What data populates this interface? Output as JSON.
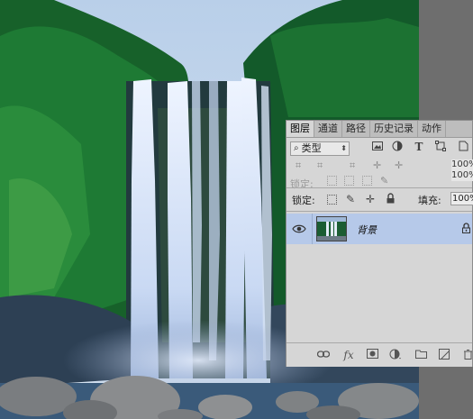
{
  "panel": {
    "tabs": [
      {
        "label": "图层",
        "active": true
      },
      {
        "label": "通道",
        "active": false
      },
      {
        "label": "路径",
        "active": false
      },
      {
        "label": "历史记录",
        "active": false
      },
      {
        "label": "动作",
        "active": false
      }
    ],
    "filter": {
      "kind_label": "类型",
      "icons": [
        "image-filter-icon",
        "adjustment-filter-icon",
        "type-filter-icon",
        "shape-filter-icon",
        "smart-object-filter-icon"
      ]
    },
    "opacity_value_ghost": "100%",
    "fill_value_ghost": "100%",
    "lock_label_ghost": "锁定:",
    "lock_label": "锁定:",
    "fill_label": "填充:",
    "fill_value": "100%",
    "layers": [
      {
        "name": "背景",
        "visible": true,
        "locked": true,
        "selected": true
      }
    ],
    "footer_buttons": [
      "link-layers-icon",
      "fx-icon",
      "add-mask-icon",
      "adjustment-layer-icon",
      "new-group-icon",
      "new-layer-icon",
      "delete-layer-icon"
    ],
    "fx_label": "fx"
  },
  "colors": {
    "panel_bg": "#d6d6d6",
    "selected_row": "#b6c9e9",
    "canvas_gray": "#6e6e6e",
    "sky": "#c6d8ee"
  }
}
